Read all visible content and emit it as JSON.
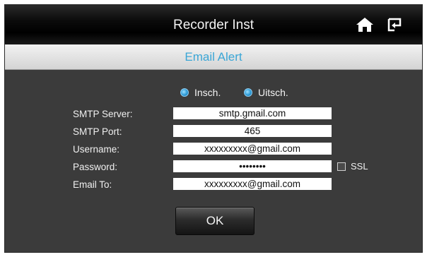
{
  "header": {
    "title": "Recorder Inst"
  },
  "icons": {
    "home": "home-icon",
    "back": "return-icon"
  },
  "subheader": {
    "title": "Email Alert"
  },
  "toggle": {
    "on_label": "Insch.",
    "off_label": "Uitsch.",
    "selected": "Insch."
  },
  "form": {
    "smtp_server": {
      "label": "SMTP Server:",
      "value": "smtp.gmail.com"
    },
    "smtp_port": {
      "label": "SMTP Port:",
      "value": "465"
    },
    "username": {
      "label": "Username:",
      "value": "xxxxxxxxx@gmail.com"
    },
    "password": {
      "label": "Password:",
      "value": "••••••••"
    },
    "email_to": {
      "label": "Email To:",
      "value": "xxxxxxxxx@gmail.com"
    },
    "ssl": {
      "label": "SSL",
      "checked": false
    }
  },
  "actions": {
    "ok_label": "OK"
  },
  "colors": {
    "accent": "#3aa6d6",
    "background": "#3b3b3b",
    "titlebar": "#000000"
  }
}
